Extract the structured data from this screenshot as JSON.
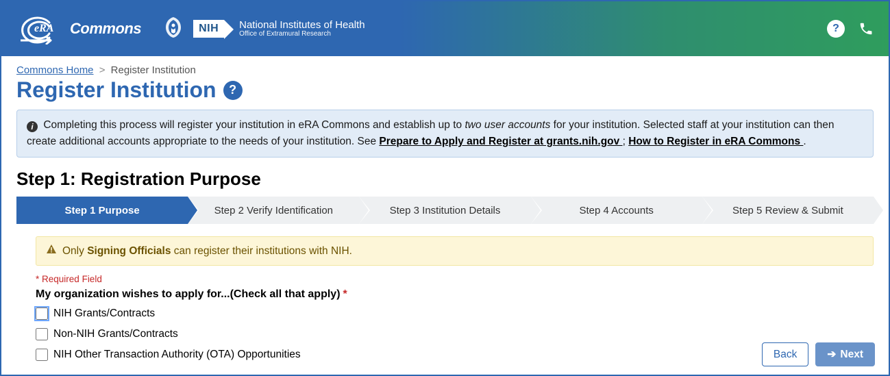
{
  "header": {
    "app": "Commons",
    "nih_title": "National Institutes of Health",
    "nih_sub": "Office of Extramural Research"
  },
  "breadcrumb": {
    "home": "Commons Home",
    "current": "Register Institution"
  },
  "page_title": "Register Institution",
  "info": {
    "pre": "Completing this process will register your institution in eRA Commons and establish up to ",
    "em": "two user accounts",
    "mid": " for your institution. Selected staff at your institution can then create additional accounts appropriate to the needs of your institution. See ",
    "link1": "Prepare to Apply and Register at grants.nih.gov ",
    "sep": "; ",
    "link2": "How to Register in eRA Commons ",
    "end": "."
  },
  "step_heading": "Step 1: Registration Purpose",
  "wizard": [
    "Step 1 Purpose",
    "Step 2 Verify Identification",
    "Step 3 Institution Details",
    "Step 4 Accounts",
    "Step 5 Review & Submit"
  ],
  "warning": {
    "pre": "Only ",
    "bold": "Signing Officials",
    "post": " can register their institutions with NIH."
  },
  "required_hint": "Required Field",
  "apply_label": "My organization wishes to apply for...(Check all that apply)",
  "options": [
    "NIH Grants/Contracts",
    "Non-NIH Grants/Contracts",
    "NIH Other Transaction Authority (OTA) Opportunities"
  ],
  "buttons": {
    "back": "Back",
    "next": "Next"
  }
}
